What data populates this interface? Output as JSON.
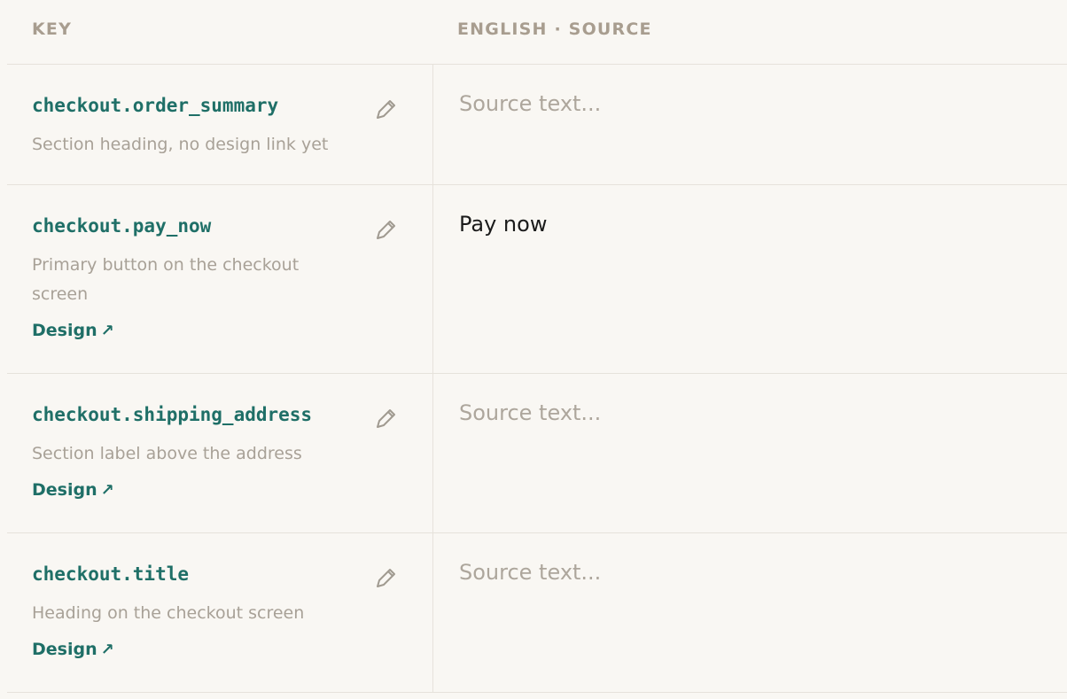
{
  "header": {
    "key_label": "KEY",
    "source_label": "ENGLISH · SOURCE"
  },
  "rows": [
    {
      "key": "checkout.order_summary",
      "description": "Section heading, no design link yet",
      "design_link": "",
      "source_value": "",
      "source_placeholder": "Source text..."
    },
    {
      "key": "checkout.pay_now",
      "description": "Primary button on the checkout screen",
      "design_link": "Design",
      "source_value": "Pay now",
      "source_placeholder": "Source text..."
    },
    {
      "key": "checkout.shipping_address",
      "description": "Section label above the address",
      "design_link": "Design",
      "source_value": "",
      "source_placeholder": "Source text..."
    },
    {
      "key": "checkout.title",
      "description": "Heading on the checkout screen",
      "design_link": "Design",
      "source_value": "",
      "source_placeholder": "Source text..."
    }
  ],
  "icons": {
    "edit": "pencil-icon",
    "design_arrow": "arrow-up-right-icon"
  },
  "colors": {
    "accent": "#1f6f67",
    "muted": "#a8a197",
    "background": "#f9f7f3",
    "border": "#e6e2db"
  }
}
